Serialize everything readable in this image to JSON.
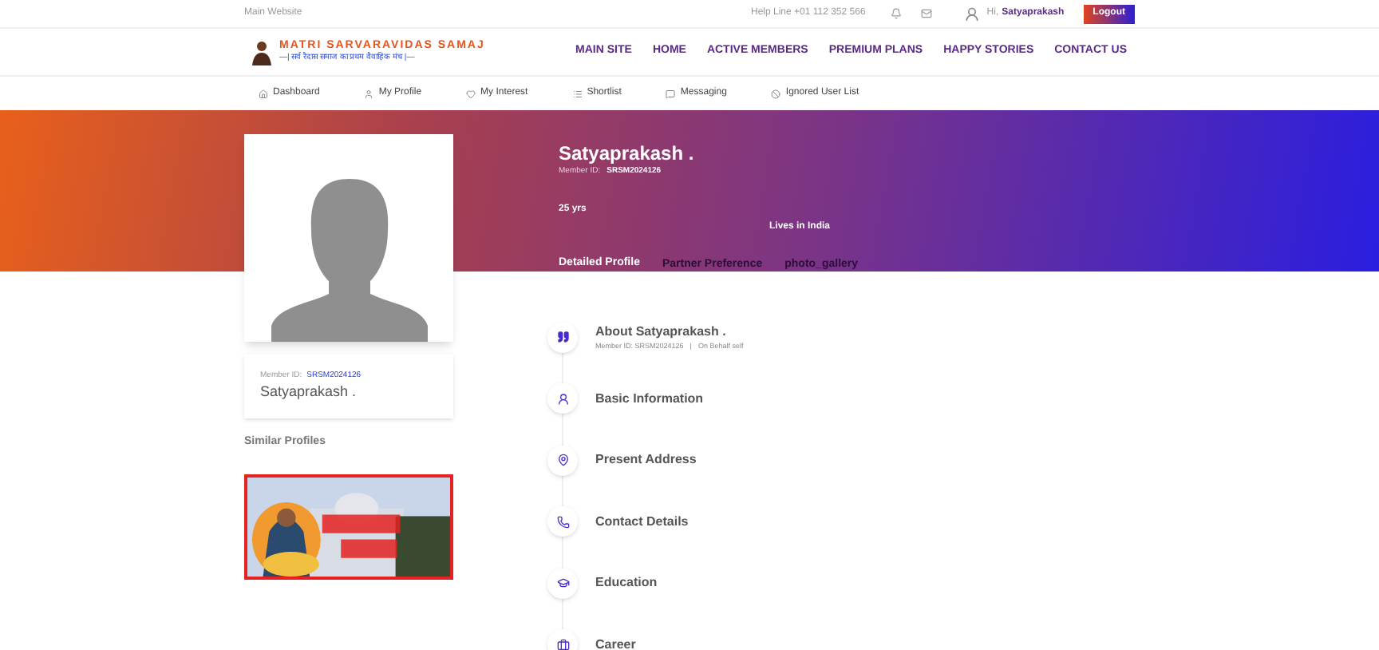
{
  "top_bar": {
    "main_website": "Main Website",
    "help_line": "Help Line +01 112 352 566",
    "greeting": "Hi,",
    "user": "Satyaprakash",
    "logout": "Logout"
  },
  "logo": {
    "title": "MATRI SARVARAVIDAS SAMAJ",
    "tagline": "—| सर्व रैदास समाज का प्रथम वैवाहिक मंच |—"
  },
  "main_nav": [
    "MAIN SITE",
    "HOME",
    "ACTIVE MEMBERS",
    "PREMIUM PLANS",
    "HAPPY STORIES",
    "CONTACT US"
  ],
  "sub_nav": [
    {
      "label": "Dashboard",
      "kind": "home"
    },
    {
      "label": "My Profile",
      "kind": "user"
    },
    {
      "label": "My Interest",
      "kind": "heart"
    },
    {
      "label": "Shortlist",
      "kind": "list"
    },
    {
      "label": "Messaging",
      "kind": "message"
    },
    {
      "label": "Ignored User List",
      "kind": "ban"
    }
  ],
  "profile": {
    "name": "Satyaprakash .",
    "member_id_label": "Member ID:",
    "member_id": "SRSM2024126",
    "age": "25 yrs",
    "location": "Lives in India"
  },
  "tabs": [
    {
      "label": "Detailed Profile",
      "selected": true
    },
    {
      "label": "Partner Preference",
      "selected": false
    },
    {
      "label": "photo_gallery",
      "selected": false
    }
  ],
  "side_card": {
    "member_id_label": "Member ID:",
    "member_id": "SRSM2024126",
    "name": "Satyaprakash ."
  },
  "similar_profiles": {
    "title": "Similar Profiles"
  },
  "sections": [
    {
      "title": "About Satyaprakash .",
      "kind": "quote",
      "meta": [
        "Member ID: SRSM2024126",
        "|",
        "On Behalf self"
      ]
    },
    {
      "title": "Basic Information",
      "kind": "person"
    },
    {
      "title": "Present Address",
      "kind": "pin"
    },
    {
      "title": "Contact Details",
      "kind": "phone"
    },
    {
      "title": "Education",
      "kind": "cap"
    },
    {
      "title": "Career",
      "kind": "case"
    }
  ]
}
